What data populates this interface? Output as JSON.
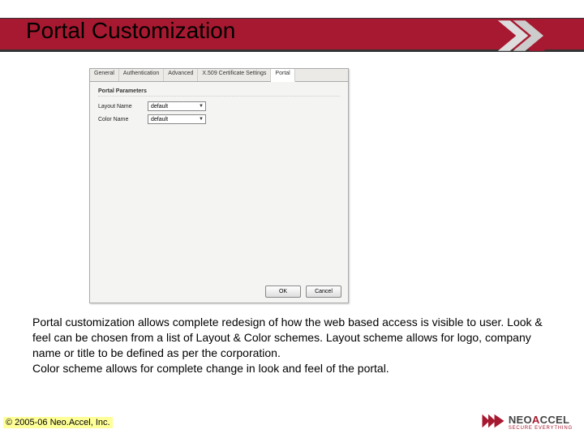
{
  "header": {
    "title": "Portal Customization"
  },
  "dialog": {
    "tabs": [
      {
        "label": "General"
      },
      {
        "label": "Authentication"
      },
      {
        "label": "Advanced"
      },
      {
        "label": "X.509 Certificate Settings"
      },
      {
        "label": "Portal"
      }
    ],
    "active_tab": 4,
    "fieldset_label": "Portal Parameters",
    "layout_label": "Layout Name",
    "layout_value": "default",
    "color_label": "Color Name",
    "color_value": "default",
    "ok_label": "OK",
    "cancel_label": "Cancel"
  },
  "body_text": "Portal customization allows complete redesign of how the web based access is visible to user. Look & feel can be chosen from a list of Layout & Color schemes. Layout scheme allows for logo, company name or title to be defined as per the corporation.\nColor scheme allows for complete change in look and feel of the portal.",
  "footer": {
    "copyright": "© 2005-06 Neo.Accel, Inc.",
    "brand_pre": "N",
    "brand_mid1": "EO",
    "brand_mid2": "A",
    "brand_post": "CCEL",
    "tagline": "SECURE EVERYTHING"
  }
}
